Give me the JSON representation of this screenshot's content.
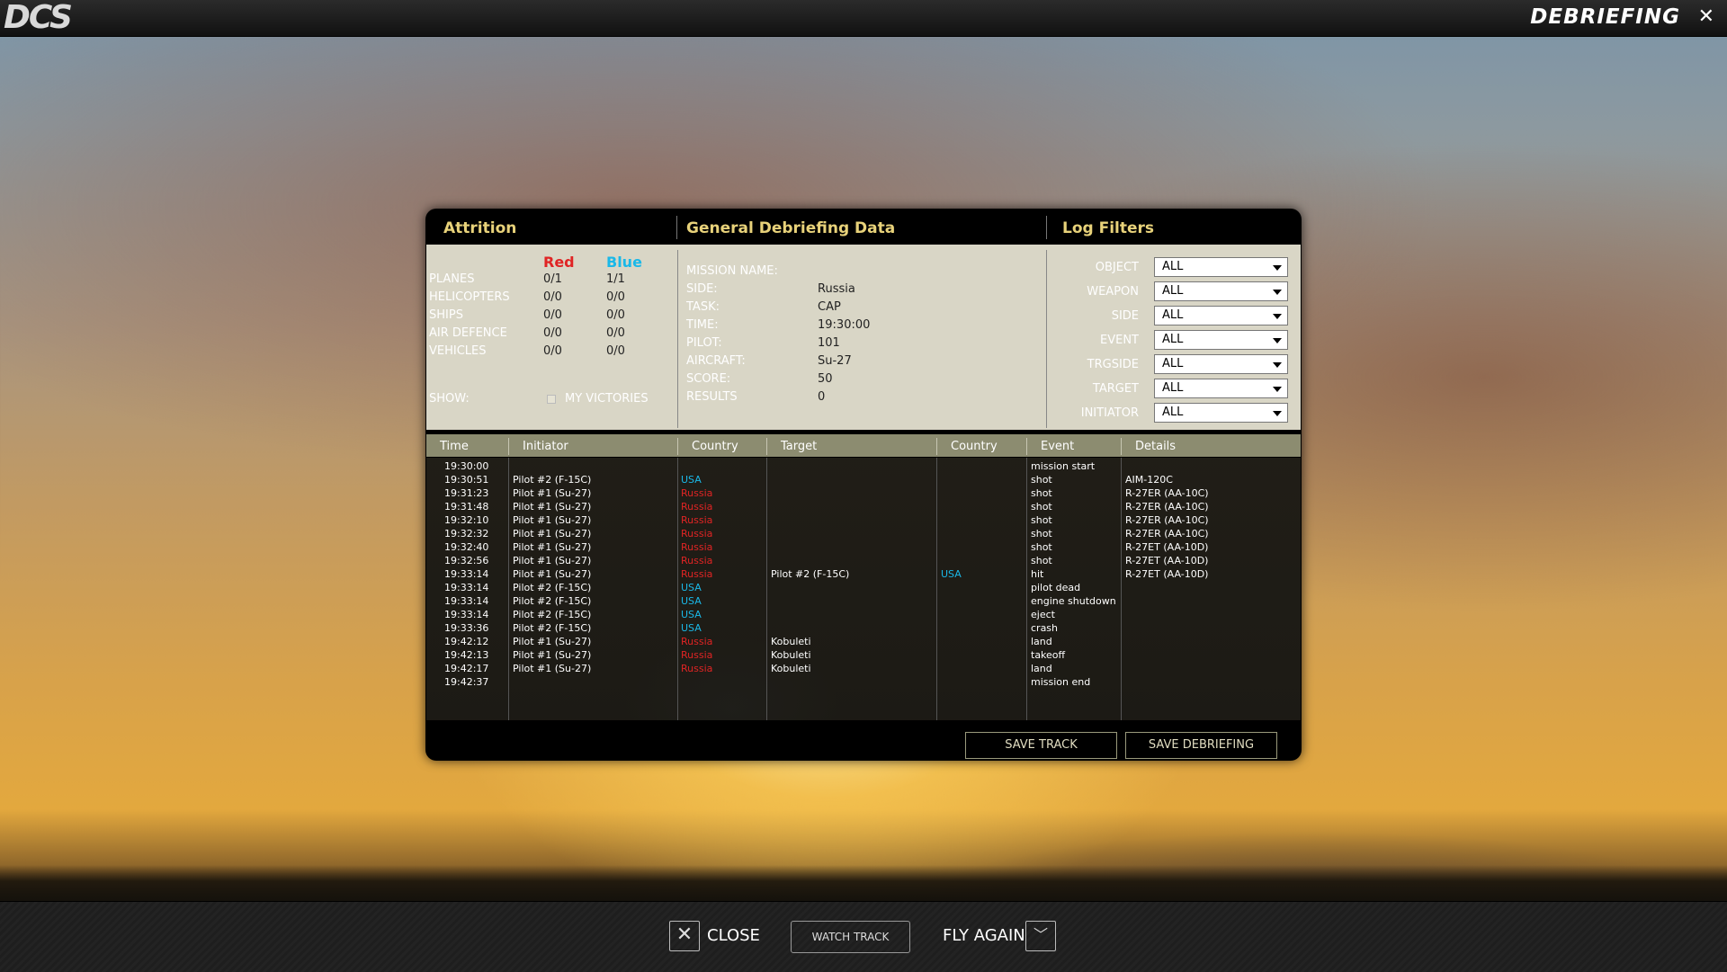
{
  "app": {
    "logo": "DCS",
    "screen_title": "DEBRIEFING",
    "close_glyph": "✕"
  },
  "colors": {
    "red": "#e02424",
    "blue": "#1ab8e8",
    "heading": "#e8d27a"
  },
  "attrition": {
    "title": "Attrition",
    "red_label": "Red",
    "blue_label": "Blue",
    "rows": [
      {
        "label": "PLANES",
        "red": "0/1",
        "blue": "1/1"
      },
      {
        "label": "HELICOPTERS",
        "red": "0/0",
        "blue": "0/0"
      },
      {
        "label": "SHIPS",
        "red": "0/0",
        "blue": "0/0"
      },
      {
        "label": "AIR DEFENCE",
        "red": "0/0",
        "blue": "0/0"
      },
      {
        "label": "VEHICLES",
        "red": "0/0",
        "blue": "0/0"
      }
    ],
    "show_label": "SHOW:",
    "my_victories_label": "MY VICTORIES",
    "my_victories_checked": false
  },
  "general": {
    "title": "General Debriefing Data",
    "rows": [
      {
        "label": "MISSION NAME:",
        "value": ""
      },
      {
        "label": "SIDE:",
        "value": "Russia"
      },
      {
        "label": "TASK:",
        "value": "CAP"
      },
      {
        "label": "TIME:",
        "value": "19:30:00"
      },
      {
        "label": "PILOT:",
        "value": "101"
      },
      {
        "label": "AIRCRAFT:",
        "value": "Su-27"
      },
      {
        "label": "SCORE:",
        "value": "50"
      },
      {
        "label": "RESULTS",
        "value": "0"
      }
    ]
  },
  "log_filters": {
    "title": "Log Filters",
    "filters": [
      {
        "label": "OBJECT",
        "value": "ALL"
      },
      {
        "label": "WEAPON",
        "value": "ALL"
      },
      {
        "label": "SIDE",
        "value": "ALL"
      },
      {
        "label": "EVENT",
        "value": "ALL"
      },
      {
        "label": "TRGSIDE",
        "value": "ALL"
      },
      {
        "label": "TARGET",
        "value": "ALL"
      },
      {
        "label": "INITIATOR",
        "value": "ALL"
      }
    ]
  },
  "log": {
    "columns": [
      "Time",
      "Initiator",
      "Country",
      "Target",
      "Country",
      "Event",
      "Details"
    ],
    "rows": [
      {
        "time": "19:30:00",
        "initiator": "",
        "country": "",
        "target": "",
        "target_country": "",
        "event": "mission start",
        "details": ""
      },
      {
        "time": "19:30:51",
        "initiator": "Pilot #2 (F-15C)",
        "country": "USA",
        "target": "",
        "target_country": "",
        "event": "shot",
        "details": "AIM-120C"
      },
      {
        "time": "19:31:23",
        "initiator": "Pilot #1 (Su-27)",
        "country": "Russia",
        "target": "",
        "target_country": "",
        "event": "shot",
        "details": "R-27ER (AA-10C)"
      },
      {
        "time": "19:31:48",
        "initiator": "Pilot #1 (Su-27)",
        "country": "Russia",
        "target": "",
        "target_country": "",
        "event": "shot",
        "details": "R-27ER (AA-10C)"
      },
      {
        "time": "19:32:10",
        "initiator": "Pilot #1 (Su-27)",
        "country": "Russia",
        "target": "",
        "target_country": "",
        "event": "shot",
        "details": "R-27ER (AA-10C)"
      },
      {
        "time": "19:32:32",
        "initiator": "Pilot #1 (Su-27)",
        "country": "Russia",
        "target": "",
        "target_country": "",
        "event": "shot",
        "details": "R-27ER (AA-10C)"
      },
      {
        "time": "19:32:40",
        "initiator": "Pilot #1 (Su-27)",
        "country": "Russia",
        "target": "",
        "target_country": "",
        "event": "shot",
        "details": "R-27ET (AA-10D)"
      },
      {
        "time": "19:32:56",
        "initiator": "Pilot #1 (Su-27)",
        "country": "Russia",
        "target": "",
        "target_country": "",
        "event": "shot",
        "details": "R-27ET (AA-10D)"
      },
      {
        "time": "19:33:14",
        "initiator": "Pilot #1 (Su-27)",
        "country": "Russia",
        "target": "Pilot #2 (F-15C)",
        "target_country": "USA",
        "event": "hit",
        "details": "R-27ET (AA-10D)"
      },
      {
        "time": "19:33:14",
        "initiator": "Pilot #2 (F-15C)",
        "country": "USA",
        "target": "",
        "target_country": "",
        "event": "pilot dead",
        "details": ""
      },
      {
        "time": "19:33:14",
        "initiator": "Pilot #2 (F-15C)",
        "country": "USA",
        "target": "",
        "target_country": "",
        "event": "engine shutdown",
        "details": ""
      },
      {
        "time": "19:33:14",
        "initiator": "Pilot #2 (F-15C)",
        "country": "USA",
        "target": "",
        "target_country": "",
        "event": "eject",
        "details": ""
      },
      {
        "time": "19:33:36",
        "initiator": "Pilot #2 (F-15C)",
        "country": "USA",
        "target": "",
        "target_country": "",
        "event": "crash",
        "details": ""
      },
      {
        "time": "19:42:12",
        "initiator": "Pilot #1 (Su-27)",
        "country": "Russia",
        "target": "Kobuleti",
        "target_country": "",
        "event": "land",
        "details": ""
      },
      {
        "time": "19:42:13",
        "initiator": "Pilot #1 (Su-27)",
        "country": "Russia",
        "target": "Kobuleti",
        "target_country": "",
        "event": "takeoff",
        "details": ""
      },
      {
        "time": "19:42:17",
        "initiator": "Pilot #1 (Su-27)",
        "country": "Russia",
        "target": "Kobuleti",
        "target_country": "",
        "event": "land",
        "details": ""
      },
      {
        "time": "19:42:37",
        "initiator": "",
        "country": "",
        "target": "",
        "target_country": "",
        "event": "mission end",
        "details": ""
      }
    ]
  },
  "dialog_buttons": {
    "save_track": "SAVE TRACK",
    "save_debriefing": "SAVE DEBRIEFING"
  },
  "bottom": {
    "close_label": "CLOSE",
    "close_icon": "✕",
    "watch_track": "WATCH TRACK",
    "fly_again": "FLY AGAIN",
    "fly_again_icon": "﹀"
  }
}
